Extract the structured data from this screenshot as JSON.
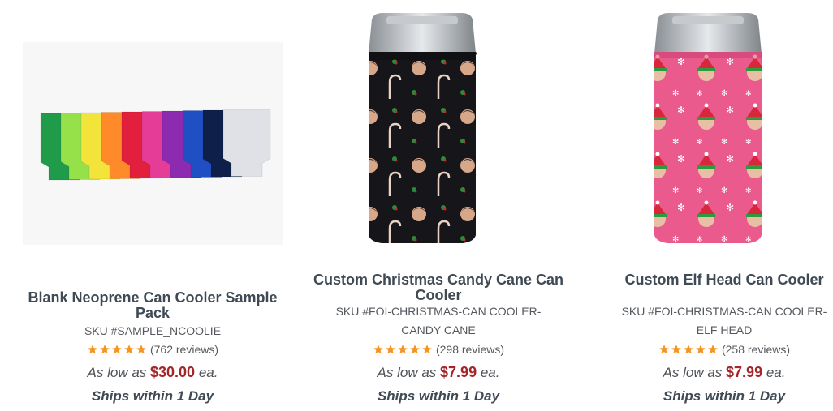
{
  "products": [
    {
      "title": "Blank Neoprene Can Cooler Sample Pack",
      "sku_line1": "SKU #SAMPLE_NCOOLIE",
      "sku_line2": "",
      "reviews": "(762 reviews)",
      "rating_stars": 5,
      "price_prefix": "As low as",
      "price": "$30.00",
      "price_suffix": "ea.",
      "ships": "Ships within 1 Day",
      "image_icon": "can-cooler-color-swatches",
      "colors": [
        "#1f9b4a",
        "#96e04a",
        "#f2e43a",
        "#ff8a2a",
        "#e21f3c",
        "#e53d97",
        "#8d2bb0",
        "#1f4fc2",
        "#0e1f4a",
        "#dfe1e6"
      ]
    },
    {
      "title": "Custom Christmas Candy Cane Can Cooler",
      "sku_line1": "SKU #FOI-CHRISTMAS-CAN COOLER-",
      "sku_line2": "CANDY CANE",
      "reviews": "(298 reviews)",
      "rating_stars": 5,
      "price_prefix": "As low as",
      "price": "$7.99",
      "price_suffix": "ea.",
      "ships": "Ships within 1 Day",
      "image_icon": "candy-cane-face-can-cooler",
      "color": "#15151a"
    },
    {
      "title": "Custom Elf Head Can Cooler",
      "sku_line1": "SKU #FOI-CHRISTMAS-CAN COOLER-",
      "sku_line2": "ELF HEAD",
      "reviews": "(258 reviews)",
      "rating_stars": 5,
      "price_prefix": "As low as",
      "price": "$7.99",
      "price_suffix": "ea.",
      "ships": "Ships within 1 Day",
      "image_icon": "elf-head-can-cooler",
      "color": "#eb5a8c"
    }
  ],
  "colors": {
    "title": "#3f4a55",
    "price": "#a3262a",
    "star": "#f7941d"
  }
}
